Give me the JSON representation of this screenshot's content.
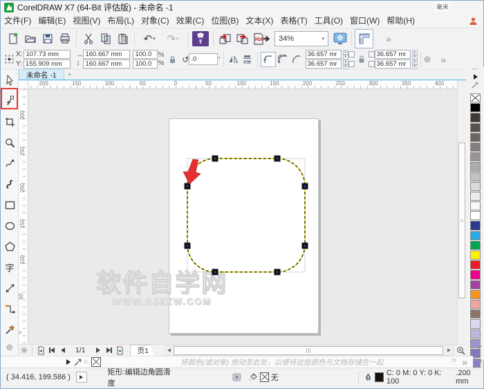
{
  "window": {
    "title": "CorelDRAW X7 (64-Bit 评估版) - 未命名 -1"
  },
  "menu": {
    "items": [
      "文件(F)",
      "编辑(E)",
      "视图(V)",
      "布局(L)",
      "对象(C)",
      "效果(C)",
      "位图(B)",
      "文本(X)",
      "表格(T)",
      "工具(O)",
      "窗口(W)",
      "帮助(H)"
    ]
  },
  "toolbar": {
    "zoom_value": "34%"
  },
  "icons": {
    "undo": "↶",
    "redo": "↷",
    "dropdown": "▾",
    "overflow": "»",
    "more": "⊕",
    "text_tool": "字",
    "pdf_label": "PDF",
    "width_glyph": "↔",
    "height_glyph": "↕",
    "rotate_glyph": "↺",
    "toolbox_tools": [
      "pick-tool",
      "shape-tool",
      "crop-tool",
      "zoom-tool",
      "freehand-tool",
      "artistic-media-tool",
      "rectangle-tool",
      "ellipse-tool",
      "polygon-tool",
      "text-tool",
      "dimension-tool",
      "connector-tool",
      "eyedropper-tool"
    ]
  },
  "prop": {
    "x_label": "X:",
    "x_value": "107.73 mm",
    "y_label": "Y:",
    "y_value": "155.909 mm",
    "w_value": "160.667 mm",
    "h_value": "160.667 mm",
    "scale_h": "100.0",
    "scale_v": "100.0",
    "pct": "%",
    "rotation": ".0",
    "deg": "°",
    "r_tl": "36.657 mr",
    "r_bl": "36.657 mr",
    "r_tr": "36.657 mr",
    "r_br": "36.657 mr"
  },
  "tabs": {
    "active": "未命名 -1",
    "new_label": "+"
  },
  "rulers": {
    "horizontal": [
      "200",
      "150",
      "100",
      "50",
      "0",
      "50",
      "100",
      "150",
      "200",
      "250",
      "300",
      "350",
      "400"
    ],
    "h_unit": "毫米",
    "vertical": [
      "300",
      "250",
      "200",
      "150",
      "100",
      "50",
      "0"
    ]
  },
  "canvas": {
    "watermark_line1": "软件自学网",
    "watermark_line2": "WWW.RJZXW.COM"
  },
  "nav": {
    "pages": "1/1",
    "page_tab": "页1"
  },
  "palette_hint": {
    "text": "将颜色(或对象) 拖动至此处，以便将这些颜色与文档存储在一起"
  },
  "status": {
    "coords": "( 34.416, 199.586 )",
    "tool_hint": "矩形:编辑边角圆滑度",
    "fill_none": "无",
    "outline_color": "C: 0 M: 0 Y: 0 K: 100",
    "outline_width": ".200 mm"
  },
  "palette": {
    "colors": [
      "#000000",
      "#413b38",
      "#57514e",
      "#6d6764",
      "#837e7b",
      "#999492",
      "#afabaa",
      "#c5c2c1",
      "#dbd9d8",
      "#eeedec",
      "#f9f9f9",
      "#ffffff",
      "#2b3990",
      "#29abe2",
      "#00a651",
      "#fff200",
      "#ed1c24",
      "#ec008c",
      "#a1439b",
      "#f7941e",
      "#f4a3a3",
      "#8a7468",
      "#dcd6ee",
      "#c0b5dd",
      "#a093cd",
      "#8577bd",
      "#8d7fc7"
    ]
  },
  "shape": {
    "accent_red": "#e23b32",
    "dash_yellow": "#efe100",
    "dash_black": "#333333"
  }
}
